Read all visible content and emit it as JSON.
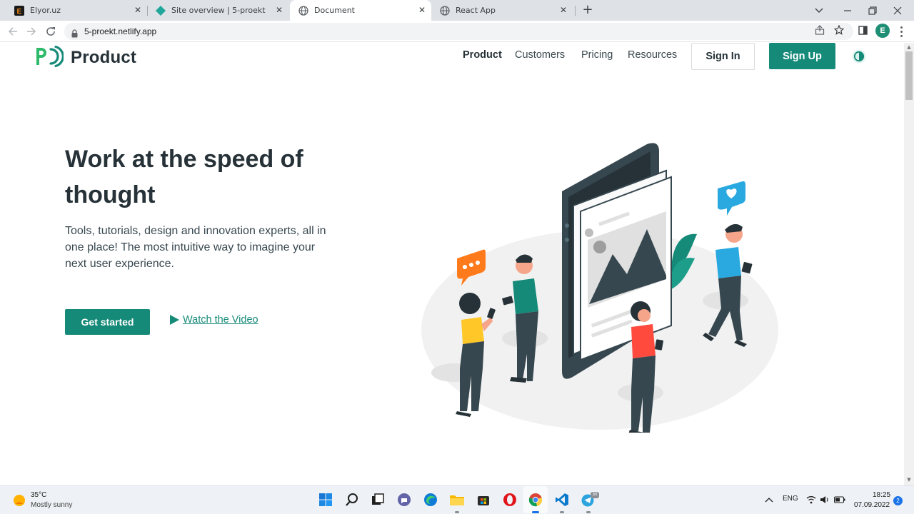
{
  "browser": {
    "tabs": [
      {
        "title": "Elyor.uz",
        "active": false,
        "icon": "elyor-favicon"
      },
      {
        "title": "Site overview | 5-proekt",
        "active": false,
        "icon": "netlify-favicon"
      },
      {
        "title": "Document",
        "active": true,
        "icon": "globe-icon"
      },
      {
        "title": "React App",
        "active": false,
        "icon": "globe-icon"
      }
    ],
    "new_tab_symbol": "+",
    "url": "5-proekt.netlify.app",
    "profile_initial": "E"
  },
  "page": {
    "brand": "Product",
    "nav": [
      {
        "label": "Product",
        "current": true
      },
      {
        "label": "Customers",
        "current": false
      },
      {
        "label": "Pricing",
        "current": false
      },
      {
        "label": "Resources",
        "current": false
      }
    ],
    "signin_label": "Sign In",
    "signup_label": "Sign Up",
    "hero": {
      "title": "Work at the speed of thought",
      "text": "Tools, tutorials, design and innovation experts, all in one place! The most intuitive way to imagine your next user experience.",
      "cta_label": "Get started",
      "video_label": "Watch the Video"
    },
    "colors": {
      "accent": "#168a78",
      "heading": "#263238"
    }
  },
  "taskbar": {
    "weather_temp": "35°C",
    "weather_desc": "Mostly sunny",
    "language": "ENG",
    "time": "18:25",
    "date": "07.09.2022",
    "notification_count": "2",
    "telegram_badge": "30"
  }
}
